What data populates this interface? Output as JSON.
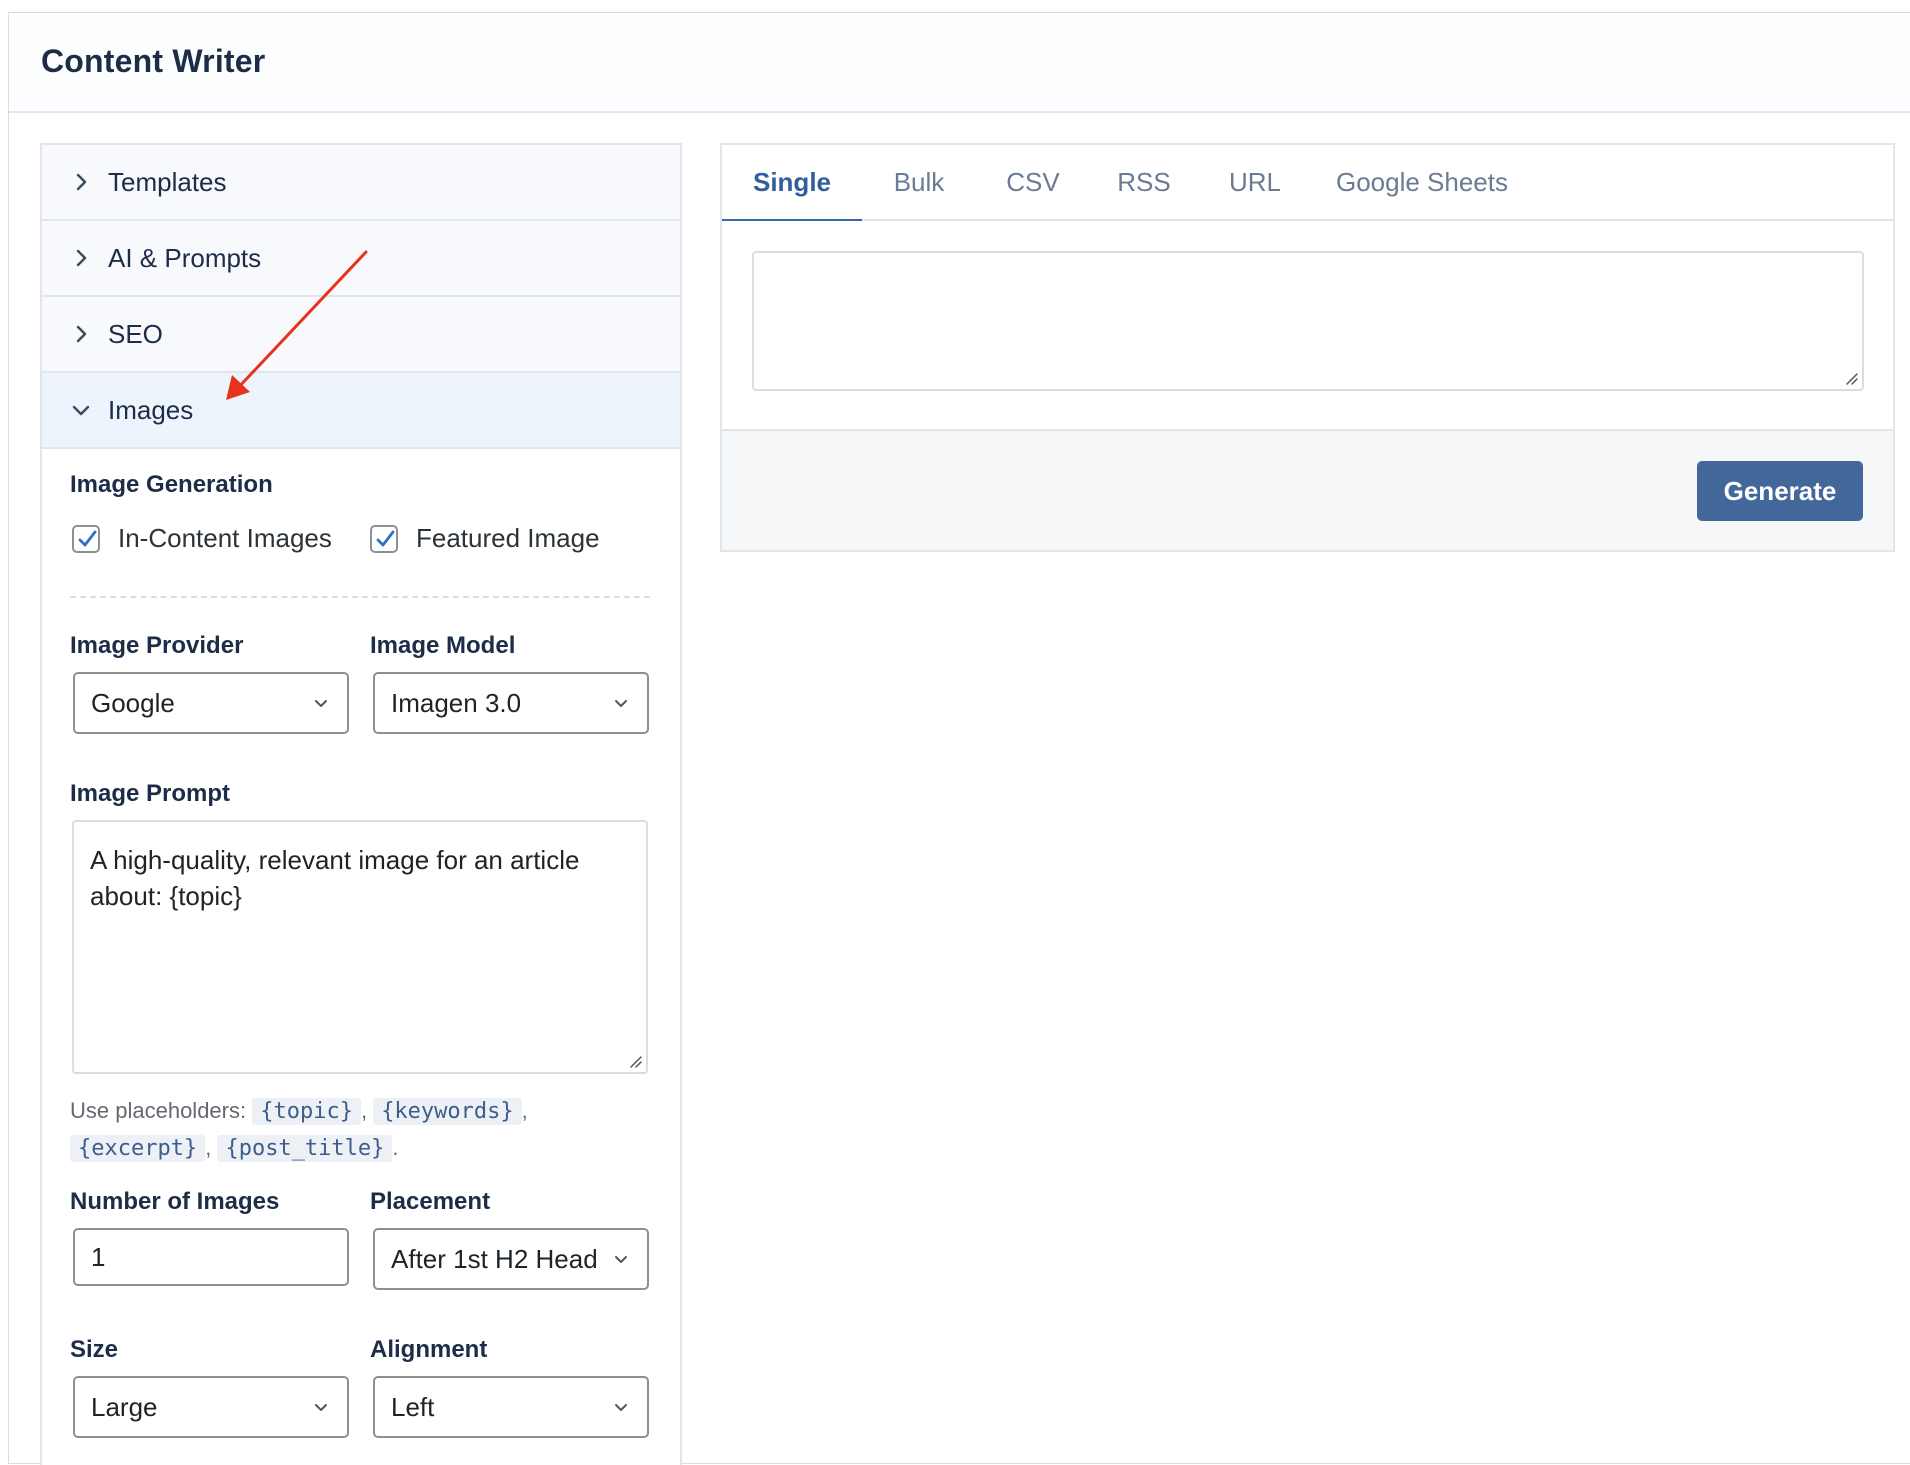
{
  "header": {
    "title": "Content Writer"
  },
  "sidebar": {
    "sections": [
      {
        "label": "Templates",
        "expanded": false
      },
      {
        "label": "AI & Prompts",
        "expanded": false
      },
      {
        "label": "SEO",
        "expanded": false
      },
      {
        "label": "Images",
        "expanded": true
      }
    ]
  },
  "images_panel": {
    "image_generation_label": "Image Generation",
    "in_content_images_label": "In-Content Images",
    "in_content_images_checked": true,
    "featured_image_label": "Featured Image",
    "featured_image_checked": true,
    "image_provider_label": "Image Provider",
    "image_provider_value": "Google",
    "image_model_label": "Image Model",
    "image_model_value": "Imagen 3.0",
    "image_prompt_label": "Image Prompt",
    "image_prompt_value": "A high-quality, relevant image for an article about: {topic}",
    "help_prefix": "Use placeholders:",
    "placeholders": [
      "{topic}",
      "{keywords}",
      "{excerpt}",
      "{post_title}"
    ],
    "number_of_images_label": "Number of Images",
    "number_of_images_value": "1",
    "placement_label": "Placement",
    "placement_value": "After 1st H2 Head",
    "size_label": "Size",
    "size_value": "Large",
    "alignment_label": "Alignment",
    "alignment_value": "Left"
  },
  "main": {
    "tabs": [
      {
        "label": "Single",
        "active": true
      },
      {
        "label": "Bulk",
        "active": false
      },
      {
        "label": "CSV",
        "active": false
      },
      {
        "label": "RSS",
        "active": false
      },
      {
        "label": "URL",
        "active": false
      },
      {
        "label": "Google Sheets",
        "active": false
      }
    ],
    "topic_input_value": "",
    "generate_label": "Generate"
  },
  "colors": {
    "accent": "#44679b",
    "active_tab": "#2f5f9c",
    "heading": "#1d2d47",
    "annotation_arrow": "#e8321e"
  },
  "icons": {
    "collapsed_chevron": "chevron-right-icon",
    "expanded_chevron": "chevron-down-icon",
    "checkbox_check": "checkmark-icon",
    "select_caret": "chevron-down-icon"
  }
}
